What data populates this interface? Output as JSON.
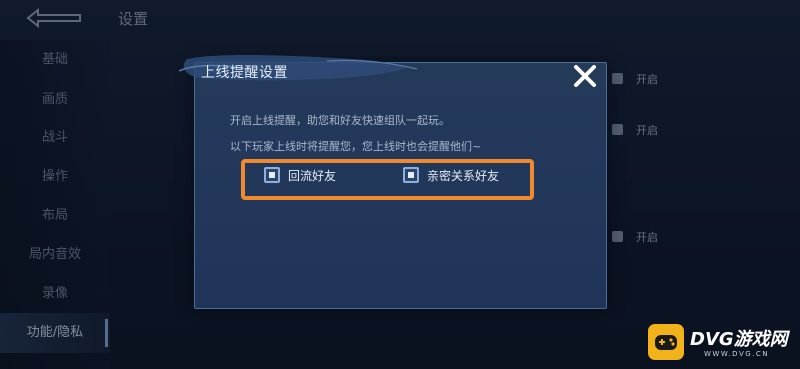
{
  "page": {
    "title": "设置",
    "back_icon": "back-arrow-icon"
  },
  "sidebar": {
    "items": [
      {
        "label": "基础"
      },
      {
        "label": "画质"
      },
      {
        "label": "战斗"
      },
      {
        "label": "操作"
      },
      {
        "label": "布局"
      },
      {
        "label": "局内音效"
      },
      {
        "label": "录像"
      },
      {
        "label": "功能/隐私",
        "active": true
      }
    ]
  },
  "background_toggles": [
    {
      "label": "开启"
    },
    {
      "label": "开启"
    },
    {
      "label": "开启"
    }
  ],
  "dialog": {
    "title": "上线提醒设置",
    "description_1": "开启上线提醒，助您和好友快速组队一起玩。",
    "description_2": "以下玩家上线时将提醒您，您上线时也会提醒他们~",
    "options": [
      {
        "label": "回流好友",
        "checked": true
      },
      {
        "label": "亲密关系好友",
        "checked": true
      }
    ],
    "close_icon": "close-icon"
  },
  "watermark": {
    "brand": "DVG游戏网",
    "url": "WWW.DVG.CN",
    "icon": "gamepad-icon"
  },
  "colors": {
    "highlight": "#f08a2c",
    "dialog_bg": "#243a59",
    "brand_yellow": "#f2b21a"
  }
}
